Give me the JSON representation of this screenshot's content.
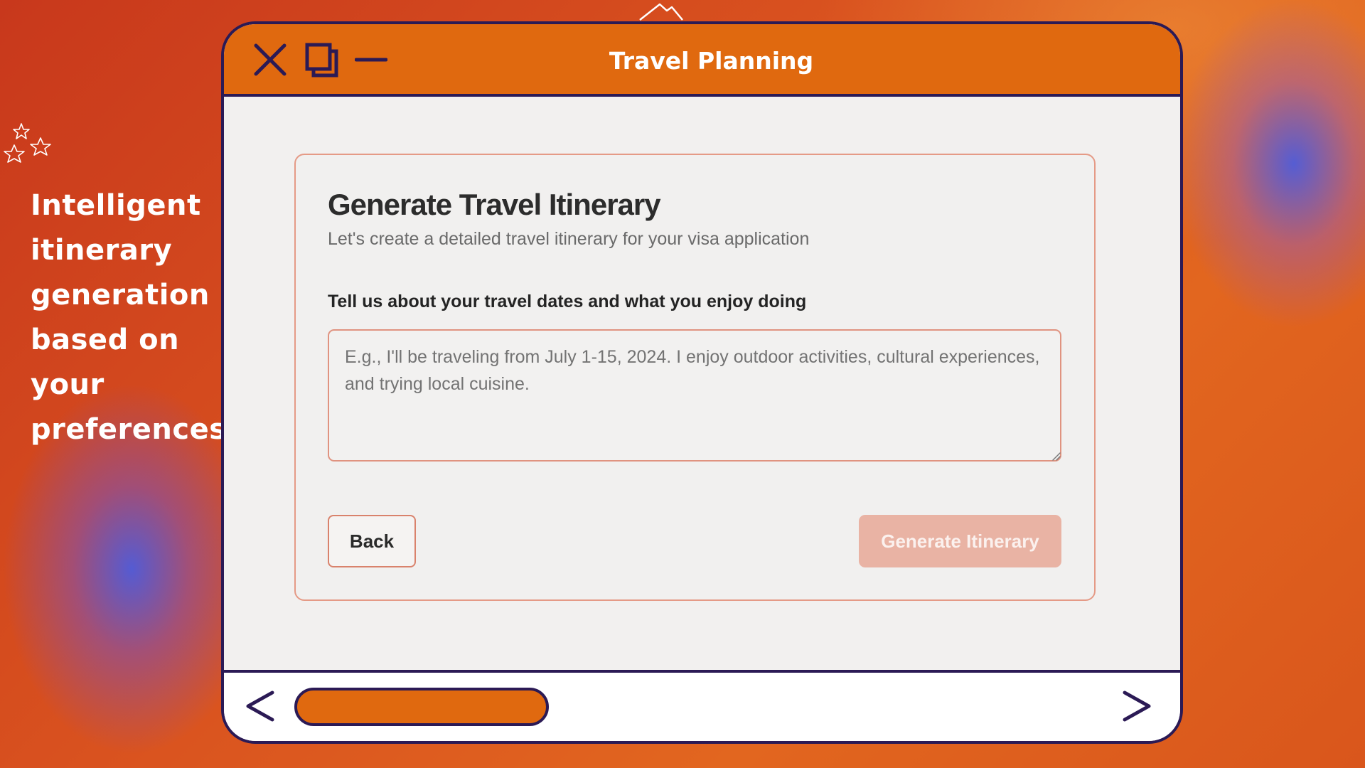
{
  "side_caption": [
    "Intelligent",
    "itinerary",
    "generation",
    "based on",
    "your",
    "preferences"
  ],
  "window": {
    "title": "Travel Planning",
    "controls": [
      "close-icon",
      "restore-icon",
      "minimize-icon"
    ]
  },
  "card": {
    "title": "Generate Travel Itinerary",
    "subtitle": "Let's create a detailed travel itinerary for your visa application",
    "field_label": "Tell us about your travel dates and what you enjoy doing",
    "textarea_placeholder": "E.g., I'll be traveling from July 1-15, 2024. I enjoy outdoor activities, cultural experiences, and trying local cuisine.",
    "textarea_value": "",
    "back_label": "Back",
    "generate_label": "Generate Itinerary"
  },
  "bottom_bar": {
    "nav": [
      "chevron-left-icon",
      "chevron-right-icon"
    ]
  },
  "colors": {
    "accent": "#e0690f",
    "outline": "#2b1a55",
    "card_border": "#e59a86",
    "generate_button_disabled": "#e9b3a4"
  }
}
